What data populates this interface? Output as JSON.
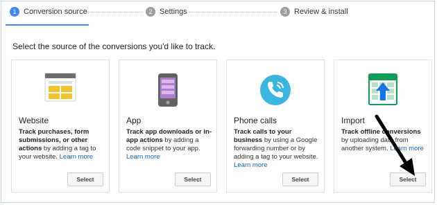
{
  "stepper": {
    "steps": [
      {
        "num": "1",
        "label": "Conversion source"
      },
      {
        "num": "2",
        "label": "Settings"
      },
      {
        "num": "3",
        "label": "Review & install"
      }
    ],
    "active_color": "#4285f4"
  },
  "prompt": "Select the source of the conversions you'd like to track.",
  "cards": [
    {
      "title": "Website",
      "icon": "website-icon",
      "desc_bold": "Track purchases, form submissions, or other actions",
      "desc_text": " by adding a tag to your website. ",
      "link": "Learn more",
      "button": "Select"
    },
    {
      "title": "App",
      "icon": "mobile-app-icon",
      "desc_bold": "Track app downloads or in-app actions",
      "desc_text": " by adding a code snippet to your app. ",
      "link": "Learn more",
      "button": "Select"
    },
    {
      "title": "Phone calls",
      "icon": "phone-icon",
      "desc_bold": "Track calls to your business",
      "desc_text": " by using a Google forwarding number or by adding a tag to your website. ",
      "link": "Learn more",
      "button": "Select"
    },
    {
      "title": "Import",
      "icon": "spreadsheet-upload-icon",
      "desc_bold": "Track offline conversions",
      "desc_text": " by uploading data from another system. ",
      "link": "Learn more",
      "button": "Select"
    }
  ]
}
